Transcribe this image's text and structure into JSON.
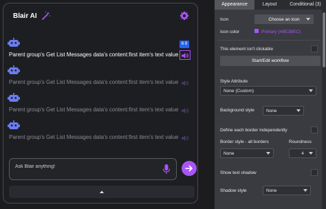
{
  "chat": {
    "title": "Blair AI",
    "messages": [
      {
        "text": "Parent group's Get List Messages data's content:first item's text value"
      },
      {
        "text": "Parent group's Get List Messages data's content:first item's text value"
      },
      {
        "text": "Parent group's Get List Messages data's content:first item's text value"
      },
      {
        "text": "Parent group's Get List Messages data's content:first item's text value"
      }
    ],
    "badge": "6 8",
    "input_placeholder": "Ask Blair anything!"
  },
  "props": {
    "tabs": [
      {
        "label": "Appearance",
        "active": true
      },
      {
        "label": "Layout",
        "active": false
      },
      {
        "label": "Conditional (3)",
        "active": false
      }
    ],
    "icon_label": "Icon",
    "icon_button": "Choose an icon",
    "icon_color_label": "Icon color",
    "icon_color_value": "Primary (#8E2BEC)",
    "not_clickable_label": "This element isn't clickable",
    "workflow_button": "Start/Edit workflow",
    "style_attr_label": "Style Attribute",
    "style_attr_value": "None (Custom)",
    "bg_style_label": "Background style",
    "bg_style_value": "None",
    "border_indep_label": "Define each border independently",
    "border_style_label": "Border style - all borders",
    "border_style_value": "None",
    "roundness_label": "Roundness",
    "roundness_value": "4",
    "text_shadow_label": "Show text shadow",
    "shadow_style_label": "Shadow style",
    "shadow_style_value": "None"
  },
  "colors": {
    "accent": "#a855f7",
    "badge": "#2563eb"
  }
}
